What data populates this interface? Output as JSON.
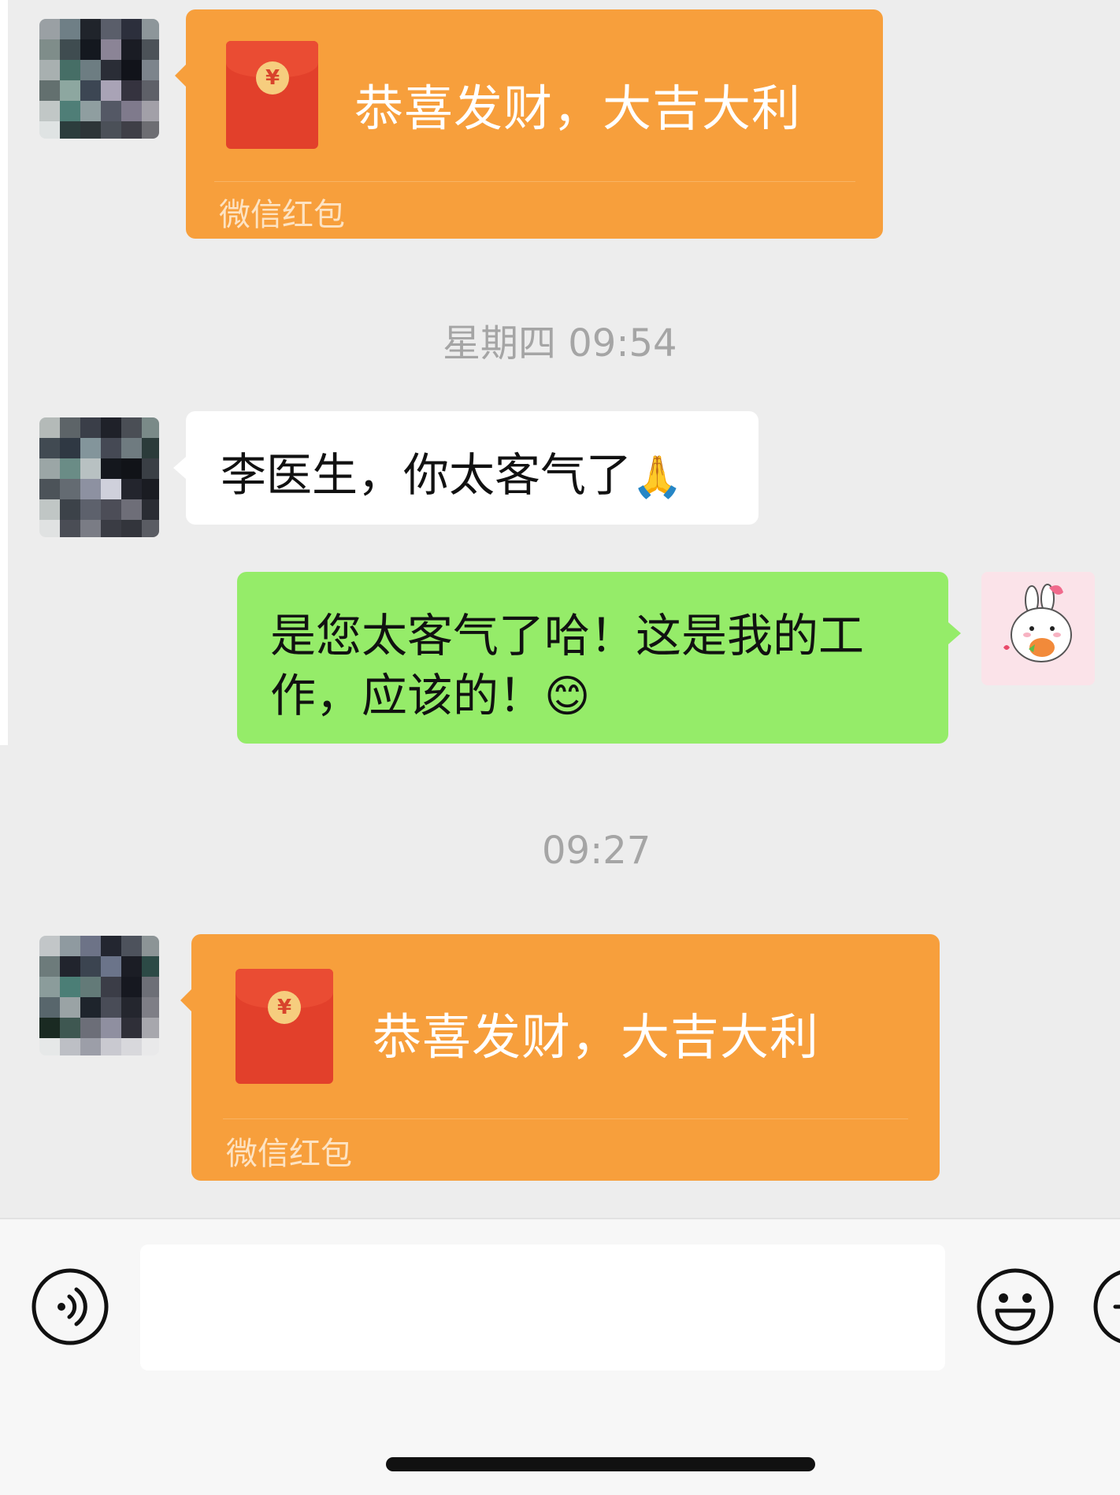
{
  "messages": [
    {
      "type": "red_packet",
      "sender": "other",
      "title": "恭喜发财，大吉大利",
      "label": "微信红包"
    },
    {
      "type": "timestamp",
      "text": "星期四 09:54"
    },
    {
      "type": "text",
      "sender": "other",
      "text": "李医生，你太客气了",
      "emoji": "🙏"
    },
    {
      "type": "text",
      "sender": "self",
      "lines": [
        "是您太客气了哈！这是我的工",
        "作，应该的！"
      ],
      "emoji": "😊"
    },
    {
      "type": "timestamp",
      "text": "09:27"
    },
    {
      "type": "red_packet",
      "sender": "other",
      "title": "恭喜发财，大吉大利",
      "label": "微信红包"
    }
  ],
  "input_bar": {
    "voice_icon": "voice-icon",
    "emoji_icon": "emoji-icon",
    "plus_icon": "plus-icon",
    "input_value": ""
  },
  "colors": {
    "red_packet": "#f79f3c",
    "self_bubble": "#95ec69",
    "other_bubble": "#ffffff",
    "background": "#ededed"
  }
}
